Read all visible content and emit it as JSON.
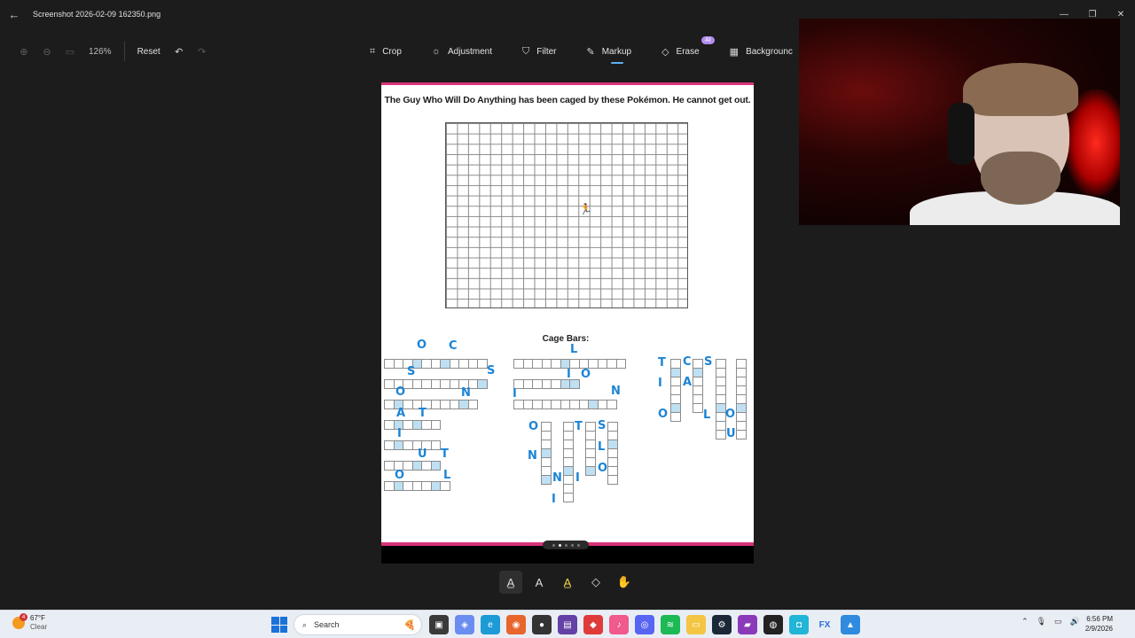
{
  "window": {
    "title": "Screenshot 2026-02-09 162350.png",
    "back_icon": "back-arrow-icon",
    "controls": [
      "minimize-icon",
      "restore-icon",
      "close-icon"
    ]
  },
  "toolbar": {
    "zoom_value": "126%",
    "reset_label": "Reset",
    "tools": [
      {
        "label": "Crop",
        "icon": "crop-icon"
      },
      {
        "label": "Adjustment",
        "icon": "brightness-icon"
      },
      {
        "label": "Filter",
        "icon": "filter-icon"
      },
      {
        "label": "Markup",
        "icon": "pen-icon",
        "active": true
      },
      {
        "label": "Erase",
        "icon": "eraser-icon",
        "badge": "AI"
      },
      {
        "label": "Backgrounc",
        "icon": "background-icon"
      }
    ]
  },
  "image": {
    "puzzle_title": "The Guy Who Will Do Anything has been caged by these Pokémon. He cannot get out.",
    "cage_label": "Cage Bars:",
    "handwriting": [
      "O",
      "C",
      "S",
      "S",
      "O",
      "N",
      "A",
      "T",
      "I",
      "U",
      "T",
      "O",
      "L",
      "L",
      "I",
      "O",
      "I",
      "N",
      "O",
      "T",
      "S",
      "N",
      "L",
      "O",
      "N",
      "I",
      "I",
      "T",
      "C",
      "S",
      "I",
      "A",
      "O",
      "L",
      "O",
      "U"
    ]
  },
  "markup_tools": [
    "ballpoint-pen-icon",
    "pencil-icon",
    "highlighter-icon",
    "eraser-icon",
    "touch-writing-icon"
  ],
  "taskbar": {
    "weather_temp": "67°F",
    "weather_cond": "Clear",
    "weather_badge": "4",
    "search_placeholder": "Search",
    "time": "6:56 PM",
    "date": "2/9/2026"
  },
  "colors": {
    "accent": "#5fb2f2",
    "image_border": "#d9327a",
    "handwriting": "#1b84d6",
    "highlight_cell": "#bfe0f2"
  }
}
